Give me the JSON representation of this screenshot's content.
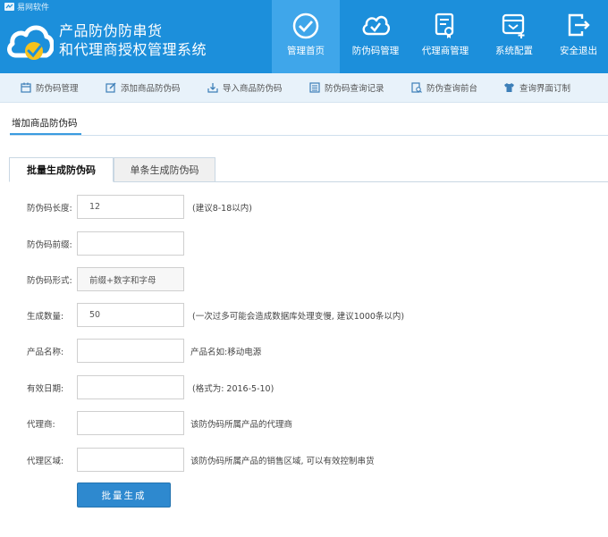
{
  "app": {
    "vendor": "易网软件",
    "title_line1": "产品防伪防串货",
    "title_line2": "和代理商授权管理系统"
  },
  "nav": [
    {
      "label": "管理首页",
      "icon": "checkmark-circle-icon",
      "active": true
    },
    {
      "label": "防伪码管理",
      "icon": "cloud-check-icon"
    },
    {
      "label": "代理商管理",
      "icon": "certificate-icon"
    },
    {
      "label": "系统配置",
      "icon": "settings-box-icon"
    },
    {
      "label": "安全退出",
      "icon": "logout-icon"
    }
  ],
  "subnav": [
    {
      "label": "防伪码管理",
      "icon": "calendar-icon"
    },
    {
      "label": "添加商品防伪码",
      "icon": "edit-icon"
    },
    {
      "label": "导入商品防伪码",
      "icon": "import-icon"
    },
    {
      "label": "防伪码查询记录",
      "icon": "list-icon"
    },
    {
      "label": "防伪查询前台",
      "icon": "search-doc-icon"
    },
    {
      "label": "查询界面订制",
      "icon": "shirt-icon"
    }
  ],
  "section": {
    "title": "增加商品防伪码"
  },
  "tabs": [
    {
      "label": "批量生成防伪码",
      "active": true
    },
    {
      "label": "单条生成防伪码"
    }
  ],
  "form": {
    "length": {
      "label": "防伪码长度:",
      "value": "12",
      "hint": "(建议8-18以内)"
    },
    "prefix": {
      "label": "防伪码前缀:",
      "value": ""
    },
    "style": {
      "label": "防伪码形式:",
      "value": "前缀+数字和字母"
    },
    "count": {
      "label": "生成数量:",
      "value": "50",
      "hint": "(一次过多可能会造成数据库处理变慢, 建议1000条以内)"
    },
    "product": {
      "label": "产品名称:",
      "value": "",
      "hint": "产品名如:移动电源"
    },
    "expiry": {
      "label": "有效日期:",
      "value": "",
      "hint": "(格式为: 2016-5-10)"
    },
    "agent": {
      "label": "代理商:",
      "value": "",
      "hint": "该防伪码所属产品的代理商"
    },
    "region": {
      "label": "代理区域:",
      "value": "",
      "hint": "该防伪码所属产品的销售区域, 可以有效控制串货"
    },
    "submit_label": "批量生成"
  },
  "colors": {
    "brand": "#1c8fdb",
    "active_nav": "#3fa6ea",
    "button": "#2e89cf"
  }
}
